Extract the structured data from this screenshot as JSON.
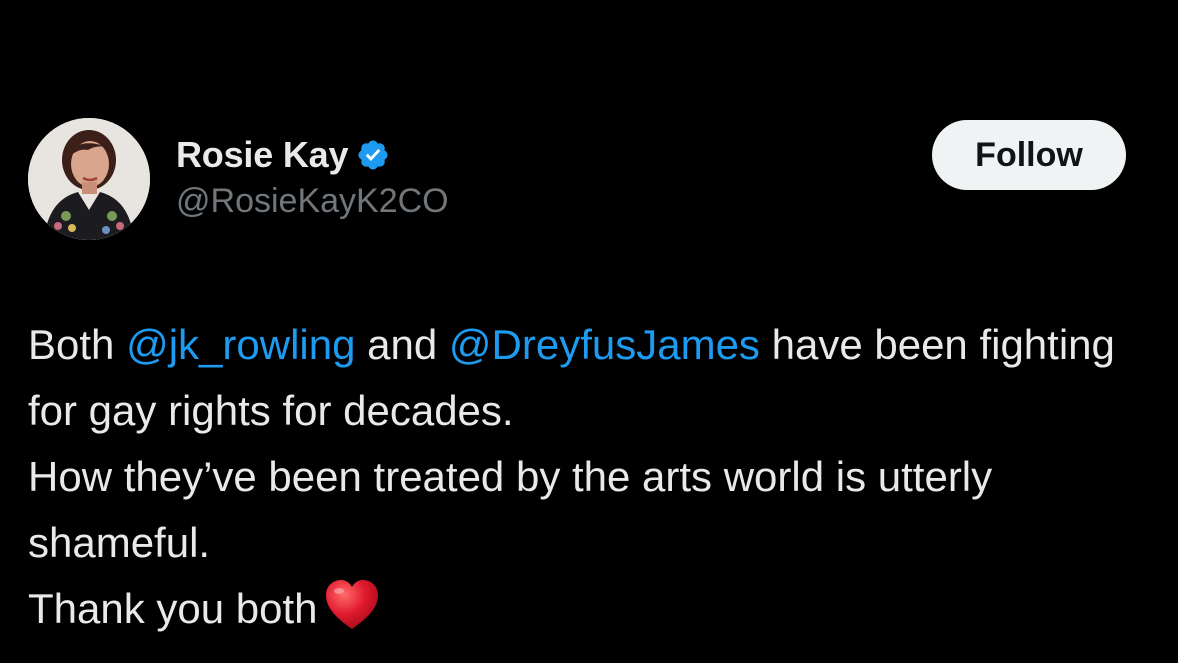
{
  "author": {
    "display_name": "Rosie Kay",
    "handle": "@RosieKayK2CO",
    "verified_icon": "verified-badge-icon",
    "avatar_icon": "profile-photo"
  },
  "actions": {
    "follow_label": "Follow"
  },
  "tweet": {
    "line1": {
      "t1": "Both ",
      "mention1": "@jk_rowling",
      "t2": " and ",
      "mention2": "@DreyfusJames",
      "t3": " have been fighting for gay rights for decades."
    },
    "line2": "How they’ve been treated by the arts world is utterly shameful.",
    "line3": "Thank you both",
    "emoji_icon": "red-heart-emoji"
  },
  "colors": {
    "background": "#000000",
    "text": "#e7e9ea",
    "secondary_text": "#71767b",
    "link": "#1d9bf0",
    "verified": "#1d9bf0",
    "button_bg": "#eff3f4",
    "button_text": "#0f1419"
  }
}
